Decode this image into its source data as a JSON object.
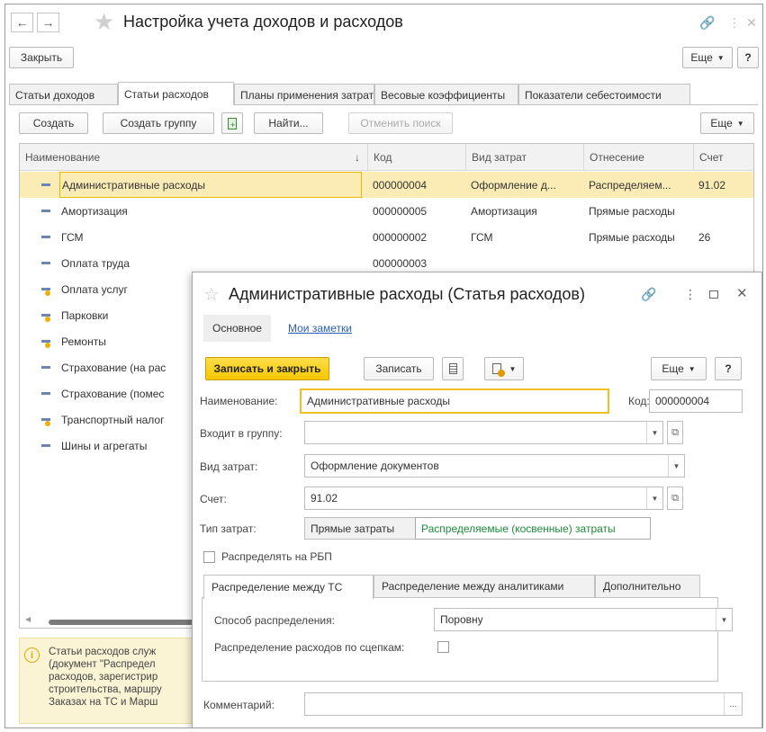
{
  "window": {
    "title": "Настройка учета доходов и расходов",
    "close_label": "Закрыть",
    "more_label": "Еще",
    "help_label": "?"
  },
  "tabs": [
    {
      "label": "Статьи доходов"
    },
    {
      "label": "Статьи расходов"
    },
    {
      "label": "Планы применения затрат"
    },
    {
      "label": "Весовые коэффициенты"
    },
    {
      "label": "Показатели себестоимости"
    }
  ],
  "list_toolbar": {
    "create": "Создать",
    "create_group": "Создать группу",
    "find": "Найти...",
    "cancel_search": "Отменить поиск",
    "more": "Еще"
  },
  "table": {
    "headers": {
      "name": "Наименование",
      "sort_arrow": "↓",
      "code": "Код",
      "cost_type": "Вид затрат",
      "attribution": "Отнесение",
      "account": "Счет"
    },
    "rows": [
      {
        "name": "Административные расходы",
        "code": "000000004",
        "cost_type": "Оформление д...",
        "attribution": "Распределяем...",
        "account": "91.02",
        "marked": false
      },
      {
        "name": "Амортизация",
        "code": "000000005",
        "cost_type": "Амортизация",
        "attribution": "Прямые расходы",
        "account": "",
        "marked": false
      },
      {
        "name": "ГСМ",
        "code": "000000002",
        "cost_type": "ГСМ",
        "attribution": "Прямые расходы",
        "account": "26",
        "marked": false
      },
      {
        "name": "Оплата труда",
        "code": "000000003",
        "cost_type": "",
        "attribution": "",
        "account": "",
        "marked": false
      },
      {
        "name": "Оплата услуг",
        "code": "",
        "cost_type": "",
        "attribution": "",
        "account": "",
        "marked": true
      },
      {
        "name": "Парковки",
        "code": "",
        "cost_type": "",
        "attribution": "",
        "account": "",
        "marked": true
      },
      {
        "name": "Ремонты",
        "code": "",
        "cost_type": "",
        "attribution": "",
        "account": "",
        "marked": true
      },
      {
        "name": "Страхование (на рас",
        "code": "",
        "cost_type": "",
        "attribution": "",
        "account": "",
        "marked": false
      },
      {
        "name": "Страхование (помес",
        "code": "",
        "cost_type": "",
        "attribution": "",
        "account": "",
        "marked": false
      },
      {
        "name": "Транспортный налог",
        "code": "",
        "cost_type": "",
        "attribution": "",
        "account": "",
        "marked": true
      },
      {
        "name": "Шины и агрегаты",
        "code": "",
        "cost_type": "",
        "attribution": "",
        "account": "",
        "marked": false
      }
    ]
  },
  "info_panel": {
    "lines": [
      "Статьи расходов служ",
      "(документ \"Распредел",
      "расходов, зарегистрир",
      "строительства, маршру",
      "Заказах на ТС и Марш"
    ]
  },
  "dialog": {
    "title": "Административные расходы (Статья расходов)",
    "tab_main": "Основное",
    "tab_notes": "Мои заметки",
    "save_close": "Записать и закрыть",
    "save": "Записать",
    "more": "Еще",
    "help": "?",
    "name_label": "Наименование:",
    "name_value": "Административные расходы",
    "code_label": "Код:",
    "code_value": "000000004",
    "group_label": "Входит в группу:",
    "group_value": "",
    "cost_type_label": "Вид затрат:",
    "cost_type_value": "Оформление документов",
    "account_label": "Счет:",
    "account_value": "91.02",
    "expense_type_label": "Тип затрат:",
    "expense_type_direct": "Прямые затраты",
    "expense_type_indirect": "Распределяемые (косвенные) затраты",
    "rbp_label": "Распределять на РБП",
    "inner_tabs": [
      {
        "label": "Распределение между ТС"
      },
      {
        "label": "Распределение между аналитиками"
      },
      {
        "label": "Дополнительно"
      }
    ],
    "method_label": "Способ распределения:",
    "method_value": "Поровну",
    "trailer_label": "Распределение расходов по сцепкам:",
    "comment_label": "Комментарий:",
    "comment_value": "",
    "comment_button": "..."
  },
  "colors": {
    "accent_yellow": "#f5c700",
    "selected_row": "#fbecb6",
    "indirect_green": "#1e8a3c",
    "link_blue": "#2b5fb4",
    "info_bg": "#fbf4d4"
  }
}
